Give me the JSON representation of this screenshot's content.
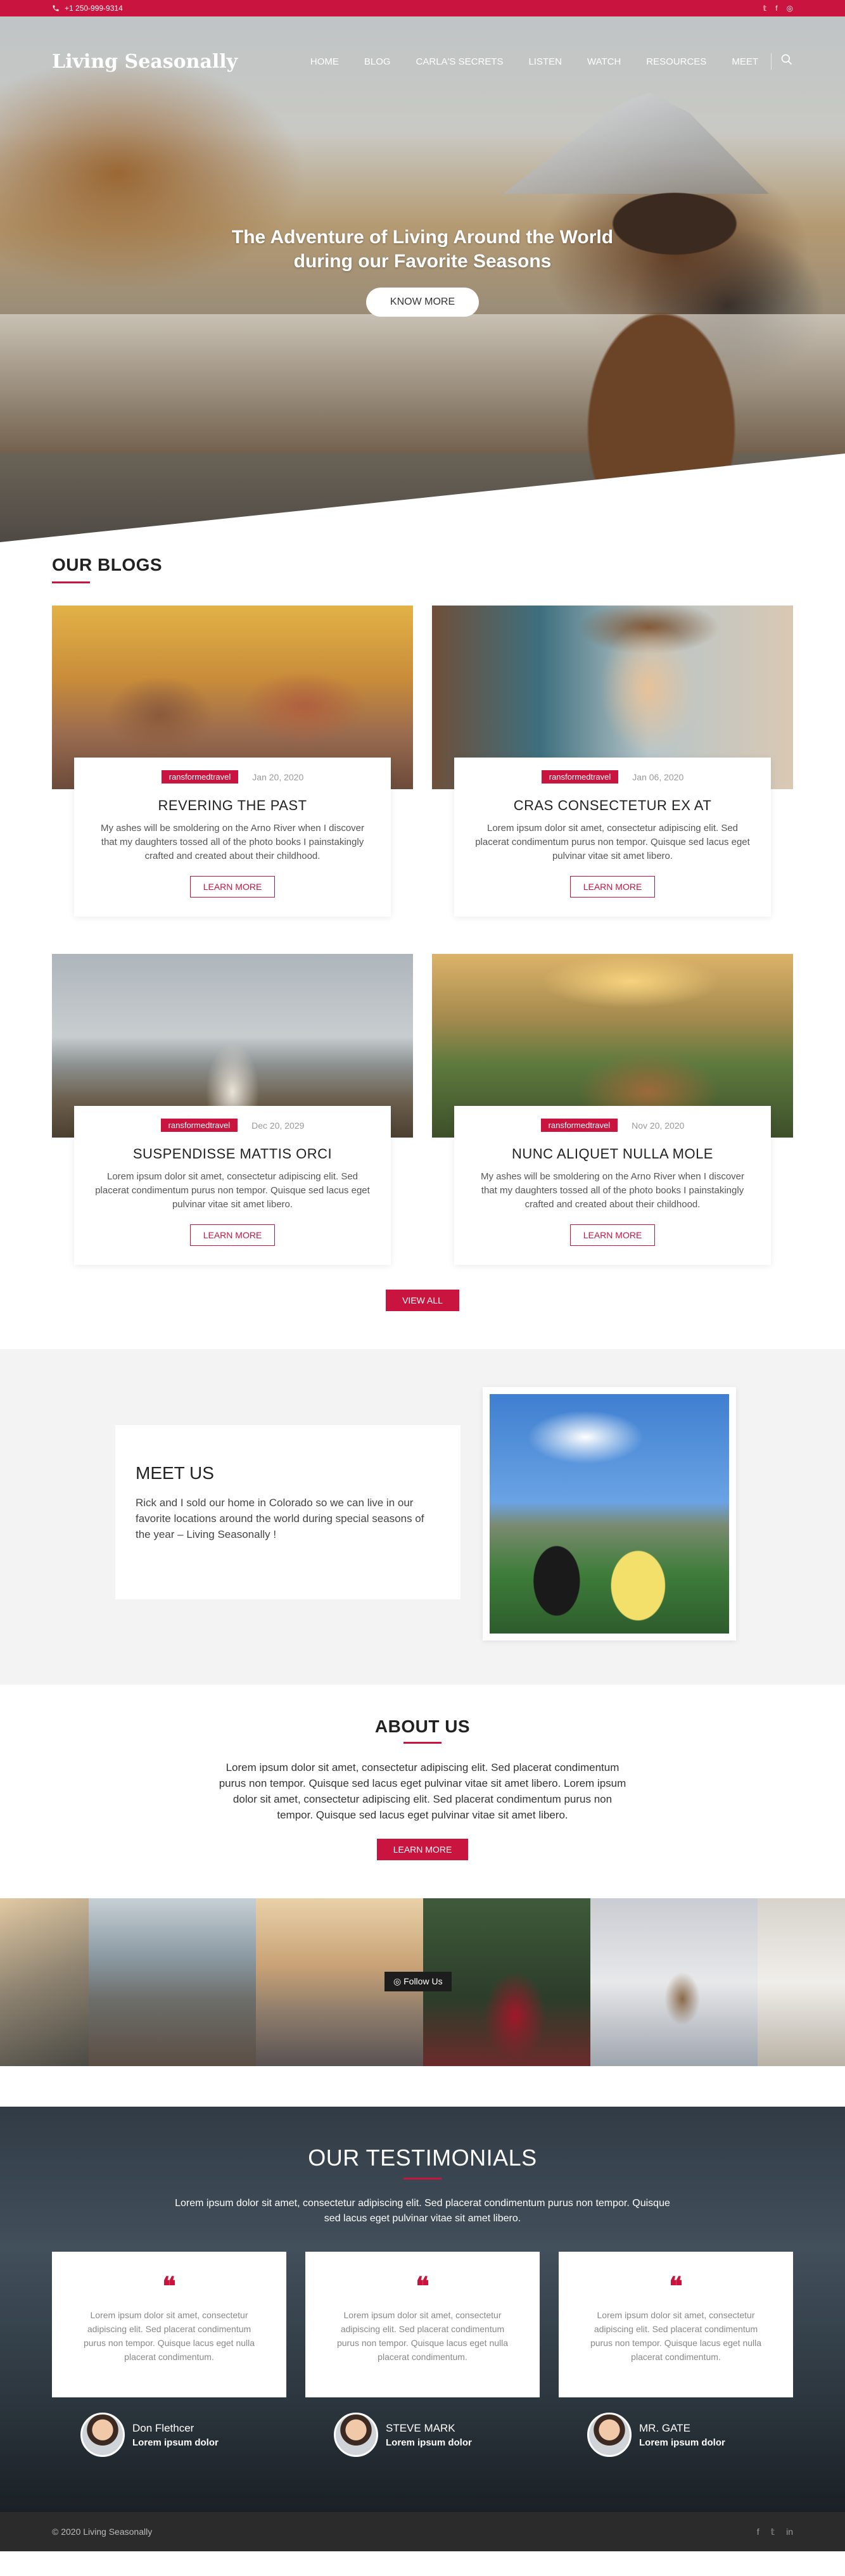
{
  "topbar": {
    "phone": "+1 250-999-9314",
    "social": [
      "twitter-icon",
      "facebook-icon",
      "instagram-icon"
    ]
  },
  "nav": {
    "logo": "Living Seasonally",
    "items": [
      {
        "label": "HOME"
      },
      {
        "label": "BLOG"
      },
      {
        "label": "CARLA'S SECRETS"
      },
      {
        "label": "LISTEN"
      },
      {
        "label": "WATCH"
      },
      {
        "label": "RESOURCES"
      },
      {
        "label": "MEET"
      }
    ]
  },
  "hero": {
    "headline": "The Adventure of Living Around the World during our Favorite Seasons",
    "cta": "KNOW MORE"
  },
  "blogs": {
    "title": "OUR BLOGS",
    "posts": [
      {
        "tag": "ransformedtravel",
        "date": "Jan 20, 2020",
        "title": "REVERING THE PAST",
        "excerpt": "My ashes will be smoldering on the Arno River when I discover that my daughters tossed all of the photo books I painstakingly crafted and created about their childhood.",
        "cta": "LEARN MORE"
      },
      {
        "tag": "ransformedtravel",
        "date": "Jan 06, 2020",
        "title": "CRAS CONSECTETUR EX AT",
        "excerpt": "Lorem ipsum dolor sit amet, consectetur adipiscing elit. Sed placerat condimentum purus non tempor. Quisque sed lacus eget  pulvinar vitae sit amet libero.",
        "cta": "LEARN MORE"
      },
      {
        "tag": "ransformedtravel",
        "date": "Dec 20, 2029",
        "title": "SUSPENDISSE MATTIS ORCI",
        "excerpt": "Lorem ipsum dolor sit amet, consectetur adipiscing elit. Sed placerat condimentum purus non tempor. Quisque sed lacus eget  pulvinar vitae sit amet libero.",
        "cta": "LEARN MORE"
      },
      {
        "tag": "ransformedtravel",
        "date": "Nov 20, 2020",
        "title": "NUNC ALIQUET NULLA MOLE",
        "excerpt": "My ashes will be smoldering on the Arno River when I discover that my daughters tossed all of the photo books I painstakingly crafted and created about their childhood.",
        "cta": "LEARN MORE"
      }
    ],
    "view_all": "VIEW ALL"
  },
  "meet": {
    "title": "MEET US",
    "text": "Rick and I sold our home in Colorado so we can live in our favorite locations around the world during special seasons of the year – Living Seasonally !"
  },
  "about": {
    "title": "ABOUT US",
    "text": "Lorem ipsum dolor sit amet, consectetur adipiscing elit. Sed placerat condimentum purus non tempor. Quisque sed lacus eget  pulvinar vitae sit amet libero. Lorem ipsum dolor sit amet, consectetur adipiscing elit. Sed placerat condimentum purus non tempor. Quisque sed lacus eget  pulvinar vitae sit amet libero.",
    "cta": "LEARN MORE"
  },
  "instagram": {
    "follow": "Follow Us"
  },
  "testimonials": {
    "title": "OUR TESTIMONIALS",
    "lead": "Lorem ipsum dolor sit amet, consectetur adipiscing elit. Sed placerat condimentum purus non tempor. Quisque sed lacus eget  pulvinar vitae sit amet libero.",
    "items": [
      {
        "quote": "Lorem ipsum dolor sit amet, consectetur adipiscing elit. Sed placerat condimentum purus non tempor. Quisque lacus eget nulla placerat condimentum.",
        "name": "Don Flethcer",
        "role": "Lorem ipsum dolor"
      },
      {
        "quote": "Lorem ipsum dolor sit amet, consectetur adipiscing elit. Sed placerat condimentum purus non tempor. Quisque lacus eget nulla placerat condimentum.",
        "name": "STEVE MARK",
        "role": "Lorem ipsum dolor"
      },
      {
        "quote": "Lorem ipsum dolor sit amet, consectetur adipiscing elit. Sed placerat condimentum purus non tempor. Quisque lacus eget nulla placerat condimentum.",
        "name": "MR. GATE",
        "role": "Lorem ipsum dolor"
      }
    ]
  },
  "footer": {
    "copyright": "© 2020 Living Seasonally",
    "social": [
      "facebook-icon",
      "twitter-icon",
      "linkedin-icon"
    ]
  },
  "colors": {
    "accent": "#c8143f",
    "footer": "#2b2b2b",
    "section_bg": "#f3f3f3"
  }
}
